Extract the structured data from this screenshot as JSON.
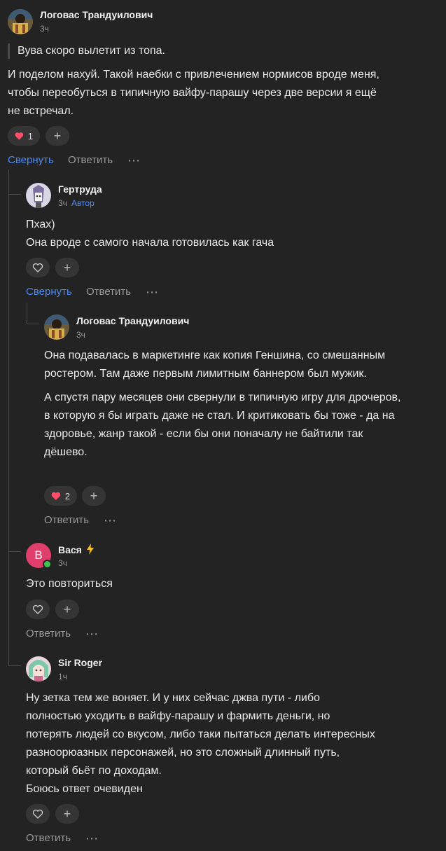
{
  "colors": {
    "background": "#232323",
    "accent": "#4c8bf5",
    "heart": "#ff4d6a",
    "lightning": "#f6c21c",
    "online": "#3ec44d"
  },
  "comments": [
    {
      "author": "Логовас Трандуилович",
      "time": "3ч",
      "quote": "Вува скоро вылетит из топа.",
      "body": [
        "И поделом нахуй. Такой наебки с привлечением нормисов вроде меня, чтобы переобуться в типичную вайфу-парашу через две версии я ещё не встречал."
      ],
      "reactions": {
        "heart_count": "1"
      },
      "actions": {
        "collapse": "Свернуть",
        "reply": "Ответить",
        "more": "⋯"
      }
    },
    {
      "author": "Гертруда",
      "time": "3ч",
      "badge": "Автор",
      "body": [
        "Пхах)",
        "Она вроде с самого начала готовилась как гача"
      ],
      "actions": {
        "collapse": "Свернуть",
        "reply": "Ответить",
        "more": "⋯"
      }
    },
    {
      "author": "Логовас Трандуилович",
      "time": "3ч",
      "body": [
        "Она подавалась в маркетинге как копия Геншина, со смешанным ростером. Там даже первым лимитным баннером был мужик.",
        "А спустя пару месяцев они свернули в типичную игру для дрочеров, в которую я бы играть даже не стал. И критиковать бы тоже - да на здоровье, жанр такой - если бы они поначалу не байтили так дёшево."
      ],
      "reactions": {
        "heart_count": "2"
      },
      "actions": {
        "reply": "Ответить",
        "more": "⋯"
      }
    },
    {
      "author": "Вася",
      "avatar_letter": "В",
      "time": "3ч",
      "body": [
        "Это повториться"
      ],
      "actions": {
        "reply": "Ответить",
        "more": "⋯"
      }
    },
    {
      "author": "Sir Roger",
      "time": "1ч",
      "body": [
        "Ну зетка тем же воняет. И у них сейчас джва пути - либо полностью уходить в вайфу-парашу и фармить деньги, но потерять людей со вкусом, либо таки пытаться делать интересных разноорюазных персонажей, но это сложный длинный путь, который бьёт по доходам.",
        "Боюсь ответ очевиден"
      ],
      "actions": {
        "reply": "Ответить",
        "more": "⋯"
      }
    }
  ],
  "icons": {
    "heart_filled": "heart-filled-icon",
    "heart_outline": "heart-outline-icon",
    "plus": "plus-icon",
    "more": "more-dots-icon",
    "lightning": "lightning-icon"
  }
}
